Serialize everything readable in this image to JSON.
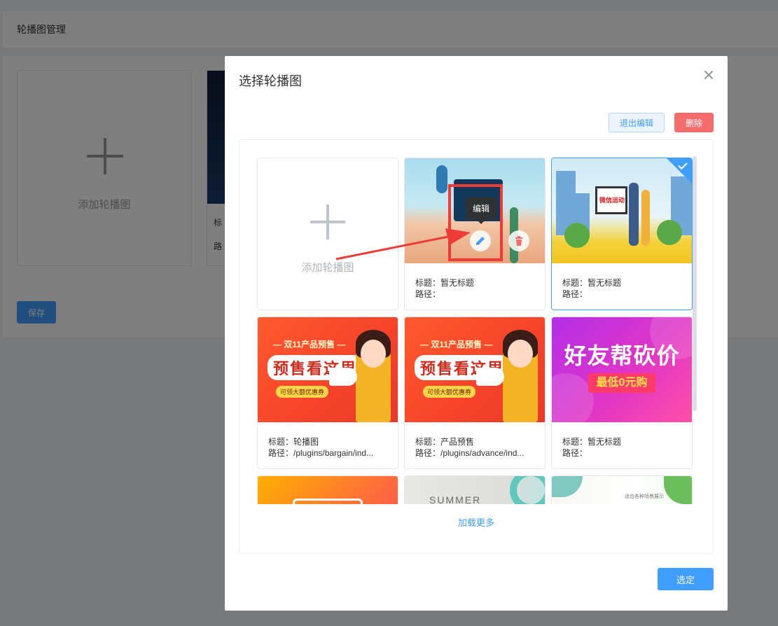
{
  "background": {
    "header_title": "轮播图管理",
    "add_label": "添加轮播图",
    "card_title_prefix": "标",
    "card_path_prefix": "路",
    "save_label": "保存"
  },
  "dialog": {
    "title": "选择轮播图",
    "exit_edit_label": "退出编辑",
    "delete_label": "删除",
    "confirm_label": "选定",
    "load_more_label": "加载更多",
    "add_label": "添加轮播图",
    "edit_tooltip": "编辑",
    "cards": [
      {
        "title": "标题：暂无标题",
        "path": "路径：",
        "thumb": "run-banner"
      },
      {
        "title": "标题：暂无标题",
        "path": "路径：",
        "thumb": "sport-banner",
        "banner_text": "微信运动",
        "selected": true
      },
      {
        "title": "标题：轮播图",
        "path": "路径：/plugins/bargain/ind...",
        "thumb": "presale-banner",
        "banner_head": "— 双11产品预售 —",
        "banner_big": "预售看这里",
        "banner_sub": "可领大额优惠券"
      },
      {
        "title": "标题：产品预售",
        "path": "路径：/plugins/advance/ind...",
        "thumb": "presale-banner",
        "banner_head": "— 双11产品预售 —",
        "banner_big": "预售看这里",
        "banner_sub": "可领大额优惠券"
      },
      {
        "title": "标题：暂无标题",
        "path": "路径：",
        "thumb": "bargain-banner",
        "banner_big": "好友帮砍价",
        "banner_sub": "最低0元购"
      },
      {
        "thumb": "yellow-banner"
      },
      {
        "thumb": "summer-banner",
        "banner_text": "SUMMER"
      },
      {
        "thumb": "leaf-banner",
        "banner_text": "适合各种场景展示"
      }
    ]
  },
  "colors": {
    "primary": "#409eff",
    "danger": "#f56c6c",
    "annotation": "#ee3b36",
    "mask": "rgba(0,0,0,0.5)"
  },
  "icons": [
    "plus-icon",
    "close-icon",
    "check-icon",
    "edit-pencil-icon",
    "trash-icon"
  ]
}
